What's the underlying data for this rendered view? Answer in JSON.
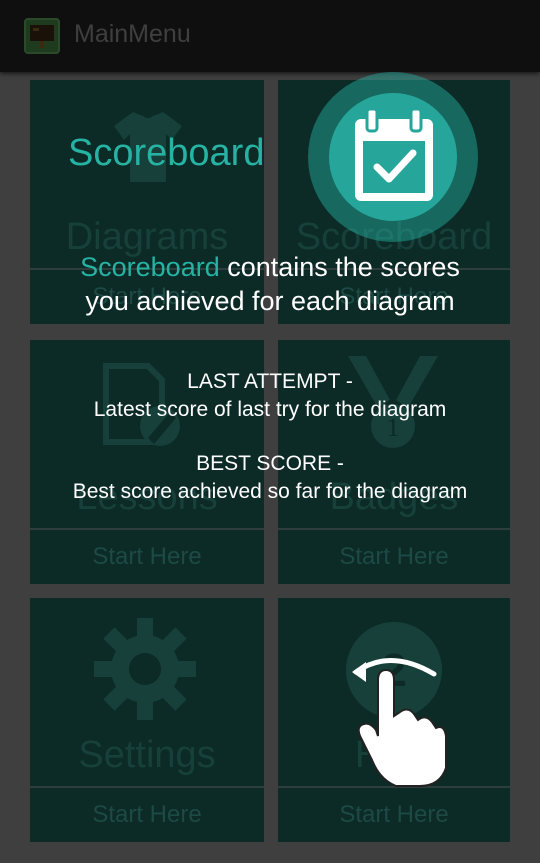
{
  "actionbar": {
    "title": "MainMenu",
    "icon": "app-logo-icon"
  },
  "tiles": [
    {
      "title": "Diagrams",
      "action": "Start Here",
      "icon": "shirt-icon"
    },
    {
      "title": "Scoreboard",
      "action": "Start Here",
      "icon": "calendar-check-icon"
    },
    {
      "title": "Lessons",
      "action": "Start Here",
      "icon": "document-edit-icon"
    },
    {
      "title": "Badges",
      "action": "Start Here",
      "icon": "medal-icon"
    },
    {
      "title": "Settings",
      "action": "Start Here",
      "icon": "gear-icon"
    },
    {
      "title": "Help",
      "action": "Start Here",
      "icon": "help-icon"
    }
  ],
  "tutorial": {
    "heading": "Scoreboard",
    "desc_highlight": "Scoreboard",
    "desc_rest": " contains the scores",
    "desc_line2": "you achieved for each diagram",
    "last_attempt_title": "LAST ATTEMPT -",
    "last_attempt_text": "Latest score of last try for the diagram",
    "best_score_title": "BEST SCORE -",
    "best_score_text": "Best score achieved so far for the diagram"
  },
  "colors": {
    "accent": "#26b3a3",
    "tile_bg": "#0c2a26"
  }
}
